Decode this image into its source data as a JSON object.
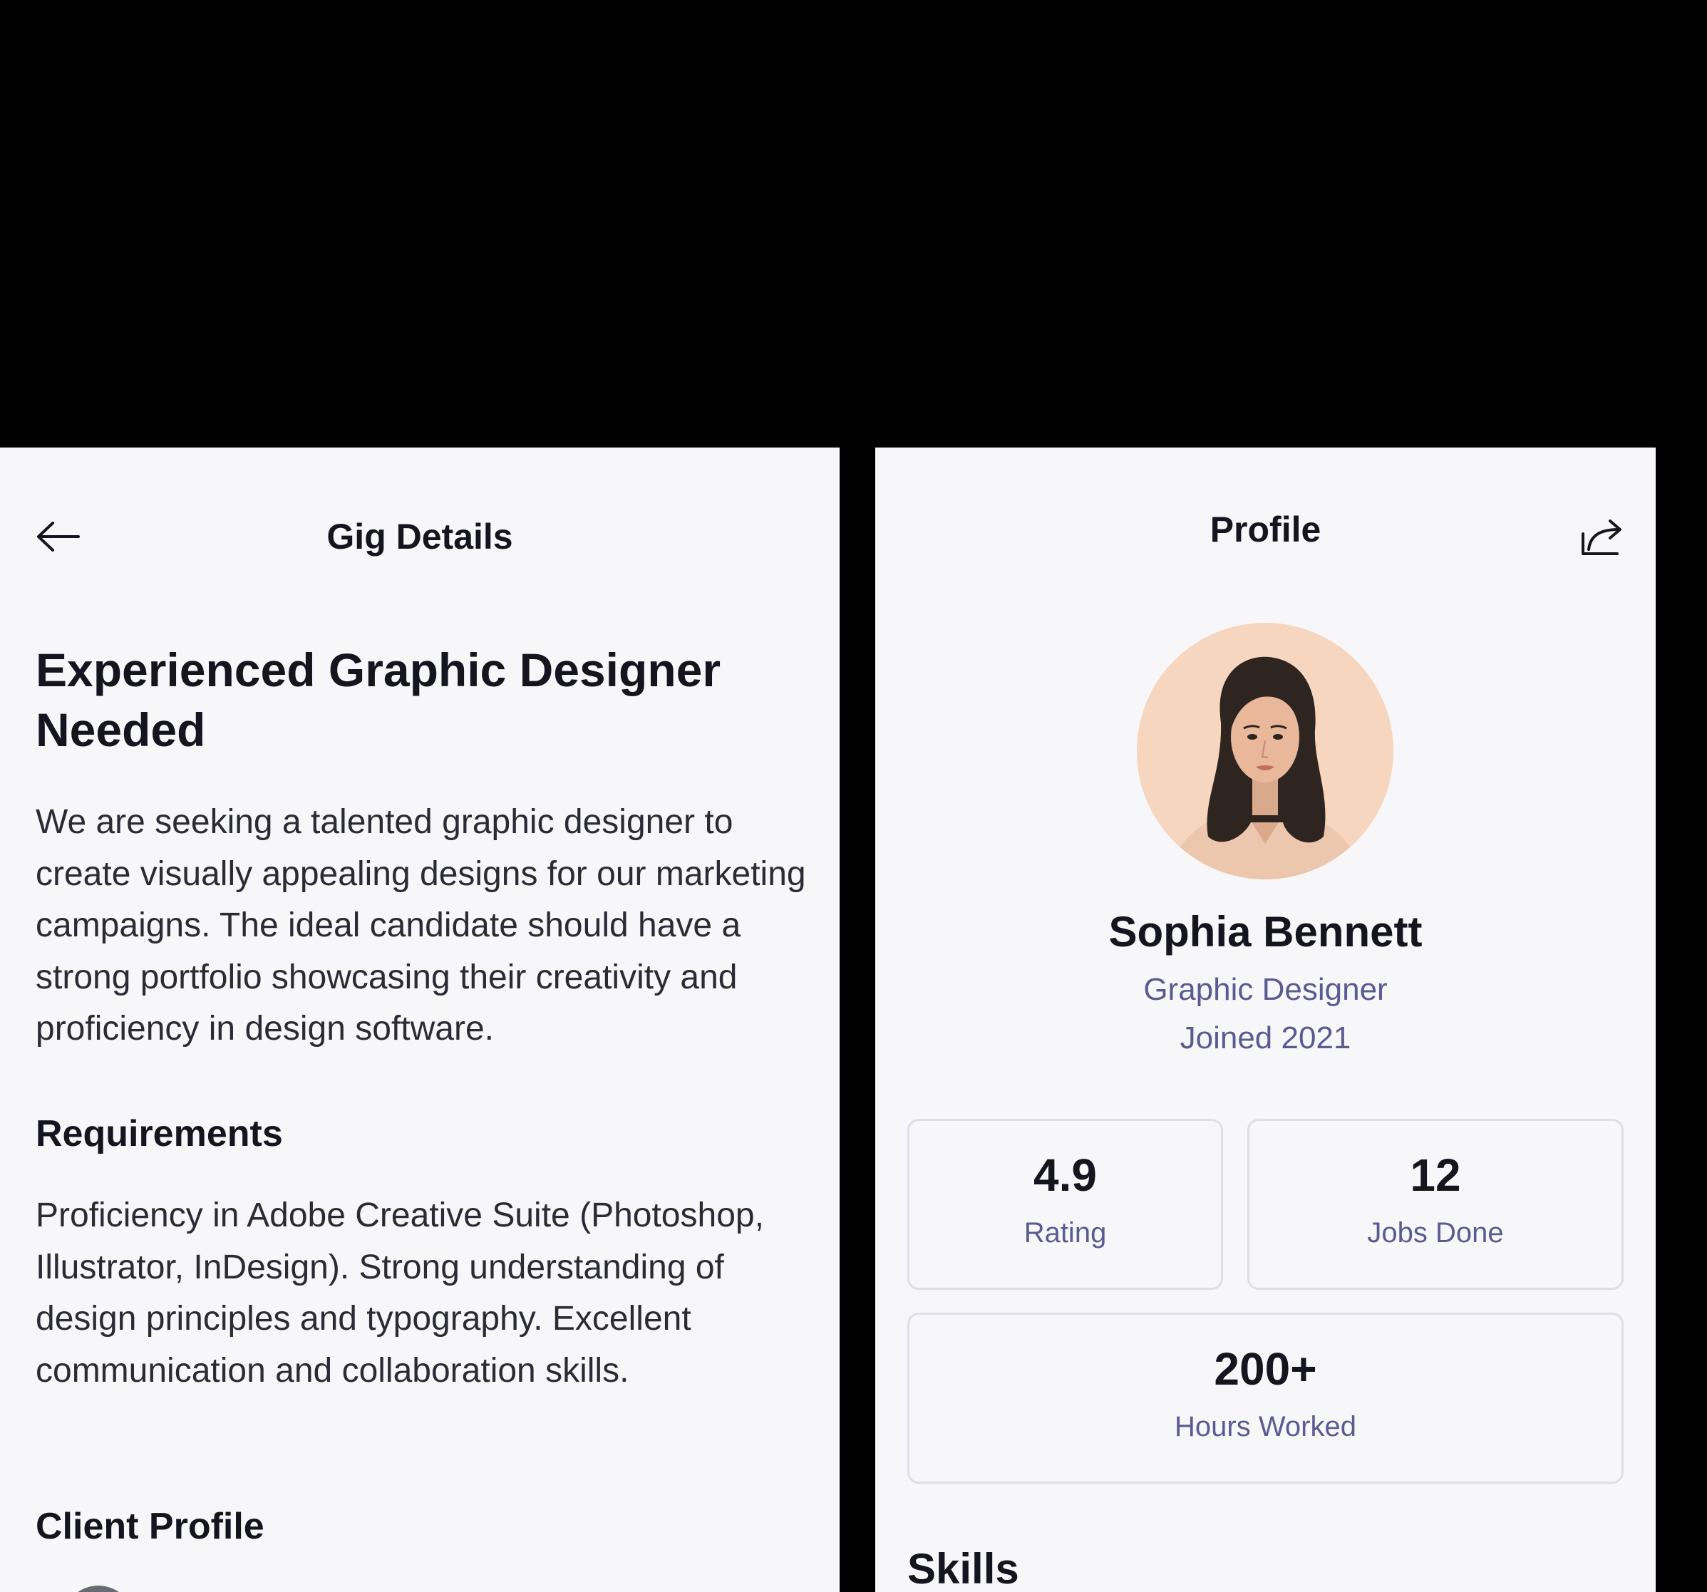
{
  "gig_screen": {
    "header": {
      "back_icon": "arrow-left-icon",
      "title": "Gig Details"
    },
    "gig_title": "Experienced Graphic Designer Needed",
    "description": "We are seeking a talented graphic designer to create visually appealing designs for our marketing campaigns. The ideal candidate should have a strong portfolio showcasing their creativity and proficiency in design software.",
    "requirements": {
      "heading": "Requirements",
      "text": "Proficiency in Adobe Creative Suite (Photoshop, Illustrator, InDesign). Strong understanding of design principles and typography. Excellent communication and collaboration skills."
    },
    "client_profile": {
      "heading": "Client Profile"
    }
  },
  "profile_screen": {
    "header": {
      "title": "Profile",
      "share_icon": "share-icon"
    },
    "avatar_icon": "avatar-illustration",
    "name": "Sophia Bennett",
    "role": "Graphic Designer",
    "joined": "Joined 2021",
    "stats": {
      "rating": {
        "value": "4.9",
        "label": "Rating"
      },
      "jobs_done": {
        "value": "12",
        "label": "Jobs Done"
      },
      "hours_worked": {
        "value": "200+",
        "label": "Hours Worked"
      }
    },
    "skills": {
      "heading": "Skills"
    }
  },
  "colors": {
    "screen_background": "#f7f7fa",
    "text_primary": "#15151f",
    "text_accent": "#5b5b92",
    "card_border": "#dedee8",
    "outer_background": "#000000"
  }
}
